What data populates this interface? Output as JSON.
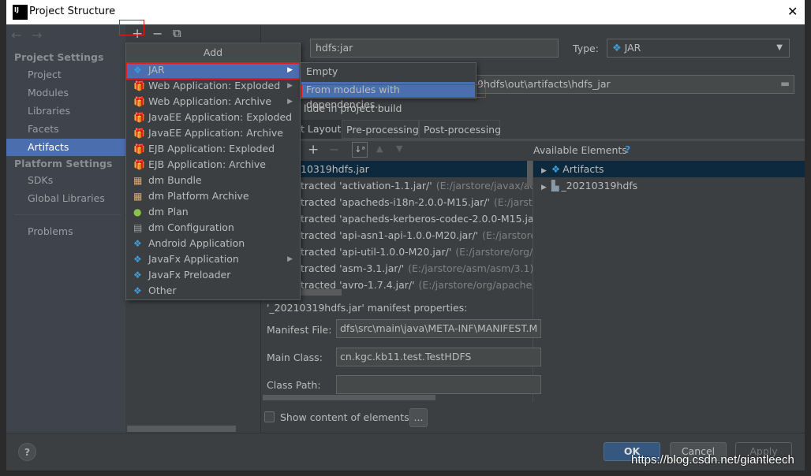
{
  "window": {
    "title": "Project Structure",
    "close": "✕"
  },
  "nav": {
    "back": "←",
    "forward": "→"
  },
  "sidebar": {
    "project_settings": "Project Settings",
    "items": [
      {
        "label": "Project"
      },
      {
        "label": "Modules"
      },
      {
        "label": "Libraries"
      },
      {
        "label": "Facets"
      },
      {
        "label": "Artifacts",
        "selected": true
      }
    ],
    "platform_settings": "Platform Settings",
    "platform_items": [
      {
        "label": "SDKs"
      },
      {
        "label": "Global Libraries"
      }
    ],
    "problems": "Problems"
  },
  "toolbar": {
    "add": "+",
    "remove": "−",
    "copy": "⧉"
  },
  "add_menu": {
    "title": "Add",
    "items": [
      {
        "label": "JAR",
        "icon": "jar-icon",
        "submenu": true,
        "selected": true
      },
      {
        "label": "Web Application: Exploded",
        "icon": "web-app-icon",
        "submenu": true
      },
      {
        "label": "Web Application: Archive",
        "icon": "web-app-icon",
        "submenu": true
      },
      {
        "label": "JavaEE Application: Exploded",
        "icon": "javaee-icon"
      },
      {
        "label": "JavaEE Application: Archive",
        "icon": "javaee-icon"
      },
      {
        "label": "EJB Application: Exploded",
        "icon": "ejb-icon"
      },
      {
        "label": "EJB Application: Archive",
        "icon": "ejb-icon"
      },
      {
        "label": "dm Bundle",
        "icon": "dm-bundle-icon"
      },
      {
        "label": "dm Platform Archive",
        "icon": "dm-platform-icon"
      },
      {
        "label": "dm Plan",
        "icon": "dm-plan-icon"
      },
      {
        "label": "dm Configuration",
        "icon": "file-icon"
      },
      {
        "label": "Android Application",
        "icon": "artifact-icon"
      },
      {
        "label": "JavaFx Application",
        "icon": "artifact-icon",
        "submenu": true
      },
      {
        "label": "JavaFx Preloader",
        "icon": "artifact-icon"
      },
      {
        "label": "Other",
        "icon": "artifact-icon"
      }
    ],
    "submenu": [
      {
        "label": "Empty"
      },
      {
        "label": "From modules with dependencies...",
        "selected": true
      }
    ]
  },
  "artifact": {
    "name": "hdfs:jar",
    "type_label": "Type:",
    "type_value": "JAR",
    "output_dir": "9hdfs\\out\\artifacts\\hdfs_jar",
    "include_build": "lude in project build",
    "tabs": [
      {
        "label": "t Layout",
        "selected": true
      },
      {
        "label": "Pre-processing"
      },
      {
        "label": "Post-processing"
      }
    ],
    "available_elements": "Available Elements",
    "help": "?",
    "layout_rows": [
      {
        "name": "10319hdfs.jar",
        "path": ""
      },
      {
        "name": "tracted 'activation-1.1.jar/'",
        "path": "(E:/jarstore/javax/activa"
      },
      {
        "name": "tracted 'apacheds-i18n-2.0.0-M15.jar/'",
        "path": "(E:/jarstore,"
      },
      {
        "name": "tracted 'apacheds-kerberos-codec-2.0.0-M15.jar/'",
        "path": ""
      },
      {
        "name": "tracted 'api-asn1-api-1.0.0-M20.jar/'",
        "path": "(E:/jarstore/o"
      },
      {
        "name": "tracted 'api-util-1.0.0-M20.jar/'",
        "path": "(E:/jarstore/org/ap"
      },
      {
        "name": "tracted 'asm-3.1.jar/'",
        "path": "(E:/jarstore/asm/asm/3.1)"
      },
      {
        "name": "tracted 'avro-1.7.4.jar/'",
        "path": "(E:/jarstore/org/apache/av"
      }
    ],
    "available_rows": [
      {
        "label": "Artifacts",
        "icon": "artifact-icon"
      },
      {
        "label": "_20210319hdfs",
        "icon": "module-folder-icon"
      }
    ],
    "manifest_title": "'_20210319hdfs.jar' manifest properties:",
    "manifest_file_label": "Manifest File:",
    "manifest_file": "dfs\\src\\main\\java\\META-INF\\MANIFEST.M",
    "main_class_label": "Main Class:",
    "main_class": "cn.kgc.kb11.test.TestHDFS",
    "class_path_label": "Class Path:",
    "class_path": "",
    "show_content": "Show content of elements",
    "show_content_checked": false,
    "more": "..."
  },
  "footer": {
    "help": "?",
    "ok": "OK",
    "cancel": "Cancel",
    "apply": "Apply"
  },
  "watermark": "https://blog.csdn.net/giantleech",
  "colors": {
    "selection": "#4b6eaf",
    "tree_selection": "#0d293e",
    "highlight_box": "#e02020",
    "accent_icon": "#3d9bd6"
  }
}
